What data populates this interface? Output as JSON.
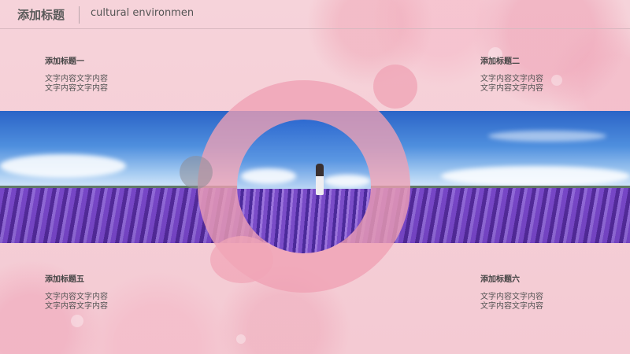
{
  "header": {
    "title": "添加标题",
    "subtitle": "cultural environmen"
  },
  "blocks": [
    {
      "title": "添加标题一",
      "line1": "文字内容文字内容",
      "line2": "文字内容文字内容"
    },
    {
      "title": "添加标题二",
      "line1": "文字内容文字内容",
      "line2": "文字内容文字内容"
    },
    {
      "title": "添加标题五",
      "line1": "文字内容文字内容",
      "line2": "文字内容文字内容"
    },
    {
      "title": "添加标题六",
      "line1": "文字内容文字内容",
      "line2": "文字内容文字内容"
    }
  ],
  "colors": {
    "background": "#f6d3da",
    "ring": "#f0a0b4",
    "text": "#444444"
  }
}
